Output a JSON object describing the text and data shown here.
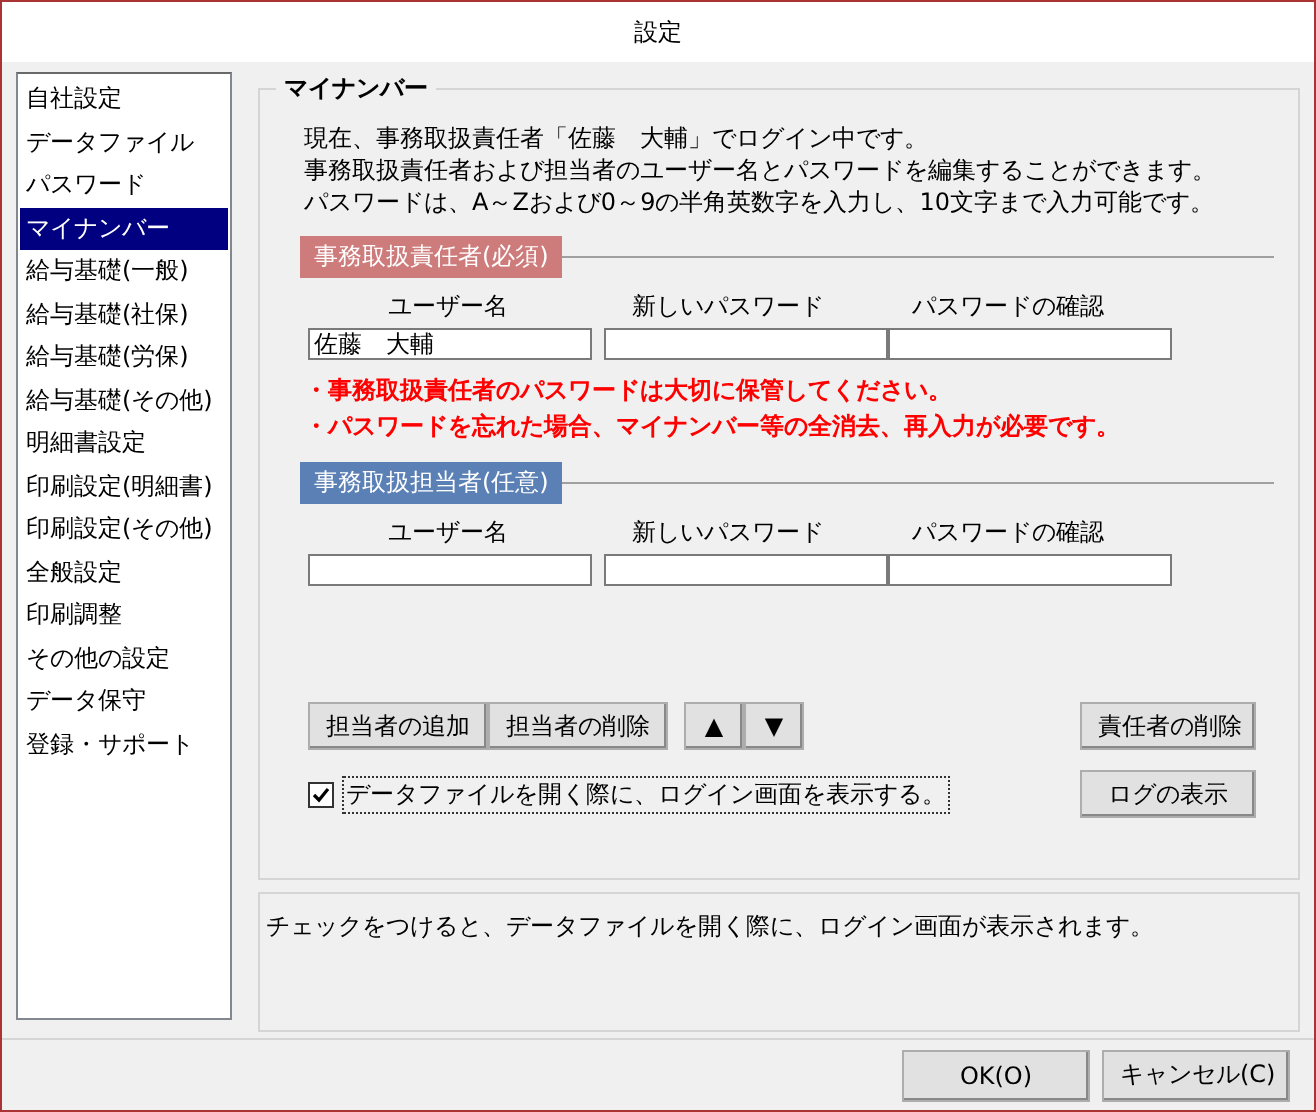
{
  "window": {
    "title": "設定"
  },
  "sidebar": {
    "items": [
      {
        "label": "自社設定",
        "selected": false
      },
      {
        "label": "データファイル",
        "selected": false
      },
      {
        "label": "パスワード",
        "selected": false
      },
      {
        "label": "マイナンバー",
        "selected": true
      },
      {
        "label": "給与基礎(一般)",
        "selected": false
      },
      {
        "label": "給与基礎(社保)",
        "selected": false
      },
      {
        "label": "給与基礎(労保)",
        "selected": false
      },
      {
        "label": "給与基礎(その他)",
        "selected": false
      },
      {
        "label": "明細書設定",
        "selected": false
      },
      {
        "label": "印刷設定(明細書)",
        "selected": false
      },
      {
        "label": "印刷設定(その他)",
        "selected": false
      },
      {
        "label": "全般設定",
        "selected": false
      },
      {
        "label": "印刷調整",
        "selected": false
      },
      {
        "label": "その他の設定",
        "selected": false
      },
      {
        "label": "データ保守",
        "selected": false
      },
      {
        "label": "登録・サポート",
        "selected": false
      }
    ]
  },
  "panel": {
    "title": "マイナンバー",
    "intro": [
      "現在、事務取扱責任者「佐藤　大輔」でログイン中です。",
      "事務取扱責任者および担当者のユーザー名とパスワードを編集することができます。",
      "パスワードは、A～Zおよび0～9の半角英数字を入力し、10文字まで入力可能です。"
    ],
    "sections": [
      {
        "kind": "required",
        "title": "事務取扱責任者(必須)",
        "columns": [
          "ユーザー名",
          "新しいパスワード",
          "パスワードの確認"
        ],
        "user_name": "佐藤　大輔",
        "warnings": [
          "・事務取扱責任者のパスワードは大切に保管してください。",
          "・パスワードを忘れた場合、マイナンバー等の全消去、再入力が必要です。"
        ]
      },
      {
        "kind": "optional",
        "title": "事務取扱担当者(任意)",
        "columns": [
          "ユーザー名",
          "新しいパスワード",
          "パスワードの確認"
        ]
      }
    ],
    "staff_buttons": [
      "担当者の追加",
      "担当者の削除"
    ],
    "order_buttons": [
      "▲",
      "▼"
    ],
    "delete_responsible_button": "責任者の削除",
    "log_button": "ログの表示",
    "login_checkbox": {
      "label": "データファイルを開く際に、ログイン画面を表示する。",
      "checked": true
    }
  },
  "hint": "チェックをつけると、データファイルを開く際に、ログイン画面が表示されます。",
  "buttons": [
    "OK(O)",
    "キャンセル(C)"
  ]
}
